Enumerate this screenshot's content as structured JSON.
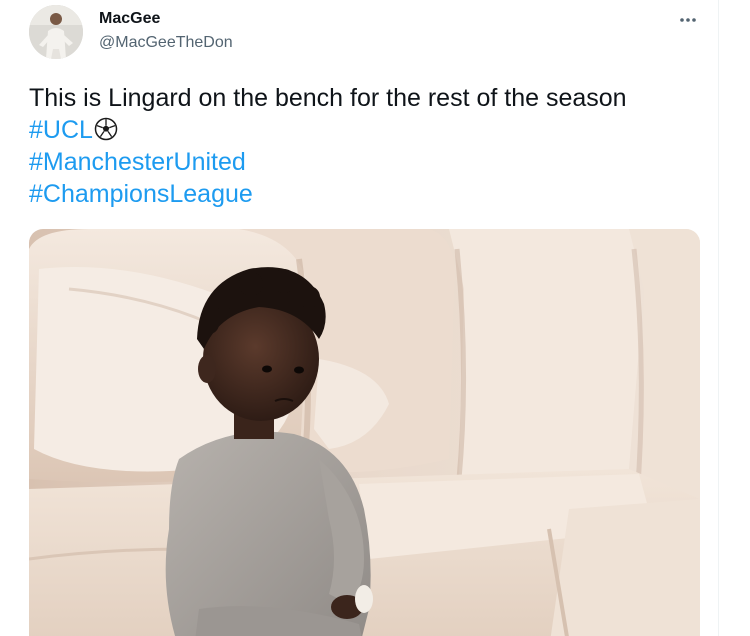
{
  "author": {
    "display_name": "MacGee",
    "handle": "@MacGeeTheDon",
    "avatar_icon": "user-avatar-photo"
  },
  "more_icon": "more-horizontal-icon",
  "tweet": {
    "text_line1": "This is Lingard on the bench for the rest of the season",
    "hashtags": [
      "#UCL",
      "#ManchesterUnited",
      "#ChampionsLeague"
    ],
    "emoji_icon": "soccer-ball-icon"
  },
  "media": {
    "kind": "photo",
    "subject": "toddler-on-sofa-photo"
  },
  "colors": {
    "text": "#0f1419",
    "secondary": "#536471",
    "link": "#1d9bf0"
  }
}
